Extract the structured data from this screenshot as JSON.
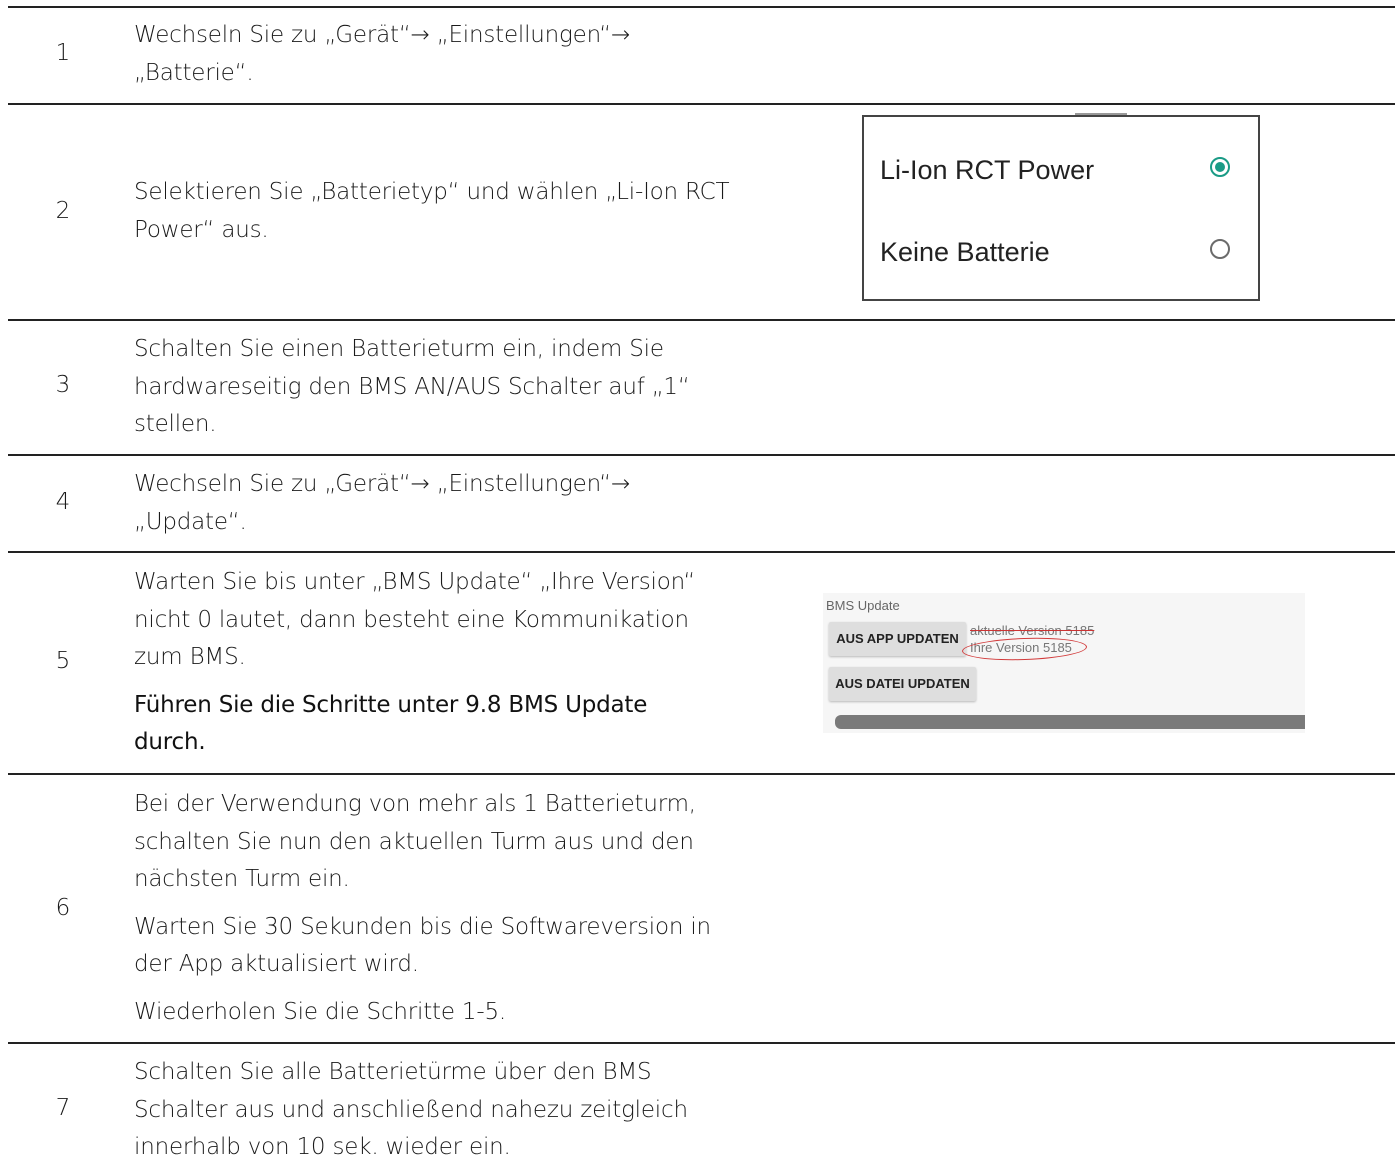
{
  "steps": [
    {
      "num": "1",
      "paragraphs": [
        {
          "text": "Wechseln Sie zu „Gerät“→ „Einstellungen“→ „Batterie“."
        }
      ]
    },
    {
      "num": "2",
      "paragraphs": [
        {
          "text": "Selektieren Sie „Batterietyp“ und wählen „Li-Ion RCT Power“ aus."
        }
      ]
    },
    {
      "num": "3",
      "paragraphs": [
        {
          "text": "Schalten Sie einen Batterieturm ein, indem Sie hardwareseitig den BMS AN/AUS Schalter auf „1“ stellen."
        }
      ]
    },
    {
      "num": "4",
      "paragraphs": [
        {
          "text": "Wechseln Sie zu „Gerät“→ „Einstellungen“→ „Update“."
        }
      ]
    },
    {
      "num": "5",
      "paragraphs": [
        {
          "text": "Warten Sie bis unter „BMS Update“ „Ihre Version“ nicht 0 lautet, dann besteht eine Kommunikation zum BMS."
        },
        {
          "text": "Führen Sie die Schritte unter 9.8 BMS Update durch."
        }
      ]
    },
    {
      "num": "6",
      "paragraphs": [
        {
          "text": "Bei der Verwendung von mehr als 1 Batterieturm, schalten Sie nun den aktuellen Turm aus und den nächsten Turm ein."
        },
        {
          "text": "Warten Sie 30 Sekunden bis die Softwareversion in der App aktualisiert wird."
        },
        {
          "text": "Wiederholen Sie die Schritte 1-5."
        }
      ]
    },
    {
      "num": "7",
      "paragraphs": [
        {
          "text": "Schalten Sie alle Batterietürme über den BMS Schalter aus und anschließend nahezu zeitgleich innerhalb von 10 sek. wieder ein."
        }
      ]
    }
  ],
  "battery_type_options": [
    {
      "label": "Li-Ion RCT Power",
      "selected": true
    },
    {
      "label": "Keine Batterie",
      "selected": false
    }
  ],
  "bms_update": {
    "title": "BMS Update",
    "app_update_button": "AUS APP UPDATEN",
    "file_update_button": "AUS DATEI UPDATEN",
    "current_version": "aktuelle Version 5185",
    "your_version": "Ihre Version 5185",
    "highlight_color": "#d23b3b"
  },
  "colors": {
    "radio_selected": "#1a9b86",
    "rule": "#222222"
  }
}
